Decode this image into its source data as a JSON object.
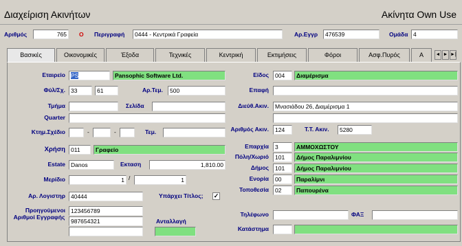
{
  "app": {
    "title": "Διαχείριση Ακινήτων",
    "subtitle": "Ακίνητα Own Use"
  },
  "header": {
    "number_label": "Αριθμός",
    "number_value": "765",
    "zero_mark": "O",
    "description_label": "Περιγραφή",
    "description_value": "0444 - Κεντρικά Γραφεία",
    "reg_label": "Αρ.Εγγρ",
    "reg_value": "476539",
    "group_label": "Ομάδα",
    "group_value": "4"
  },
  "tabs": [
    "Βασικές",
    "Οικονομικές",
    "Έξοδα",
    "Τεχνικές",
    "Κεντρική",
    "Εκτιμήσεις",
    "Φόροι",
    "Ασφ.Πυρός",
    "Α"
  ],
  "tab_nav": [
    "◄",
    "►",
    "►|"
  ],
  "form": {
    "company_label": "Εταιρείο",
    "company_code": "PS",
    "company_name": "Pansophic Software Ltd.",
    "sheet_label": "Φύλ/Σχ.",
    "sheet_a": "33",
    "sheet_b": "61",
    "plot_label": "Αρ.Τεμ.",
    "plot_value": "500",
    "section_label": "Τμήμα",
    "page_label": "Σελίδα",
    "quarter_label": "Quarter",
    "plan_label": "Κτημ.Σχέδιο",
    "plan_dash1": "-",
    "plan_dash2": "-",
    "piece_label": "Τεμ.",
    "use_label": "Χρήση",
    "use_code": "011",
    "use_name": "Γραφείο",
    "estate_label": "Estate",
    "estate_value": "Danos",
    "area_label": "Εκταση",
    "area_value": "1,810.00",
    "share_label": "Μερίδιο",
    "share_num": "1",
    "share_sep": "/",
    "share_den": "1",
    "account_label": "Αρ. Λογιστηρ",
    "account_value": "40444",
    "title_label": "Υπάρχει Τίτλος;",
    "title_checked": "✓",
    "prev_label": "Προηγούμενοι",
    "prev_value": "123456789",
    "regnum_label": "Αριθμοί Εγγραφής",
    "regnum_value": "987654321",
    "exchange_label": "Ανταλλαγή",
    "type_label": "Είδος",
    "type_code": "004",
    "type_name": "Διαμέρισμα",
    "contact_label": "Επαφή",
    "address_label": "Διεύθ.Ακιν.",
    "address_value": "Μνασιάδου 26, Διαμέρισμα 1",
    "propnum_label": "Αριθμός Ακιν.",
    "propnum_value": "124",
    "postal_label": "Τ.Τ. Ακιν.",
    "postal_value": "5280",
    "district_label": "Επαρχία",
    "district_code": "3",
    "district_name": "ΑΜΜΟΧΩΣΤΟΥ",
    "city_label": "Πόλη/Χωριό",
    "city_code": "101",
    "city_name": "Δήμος Παραλιμνίου",
    "municipality_label": "Δήμος",
    "municipality_code": "101",
    "municipality_name": "Δήμος Παραλιμνίου",
    "parish_label": "Ενορία",
    "parish_code": "00",
    "parish_name": "Παραλίμνι",
    "locality_label": "Τοποθεσία",
    "locality_code": "02",
    "locality_name": "Παπουρένα",
    "phone_label": "Τηλέφωνο",
    "fax_label": "ΦΑΞ",
    "store_label": "Κατάστημα"
  }
}
